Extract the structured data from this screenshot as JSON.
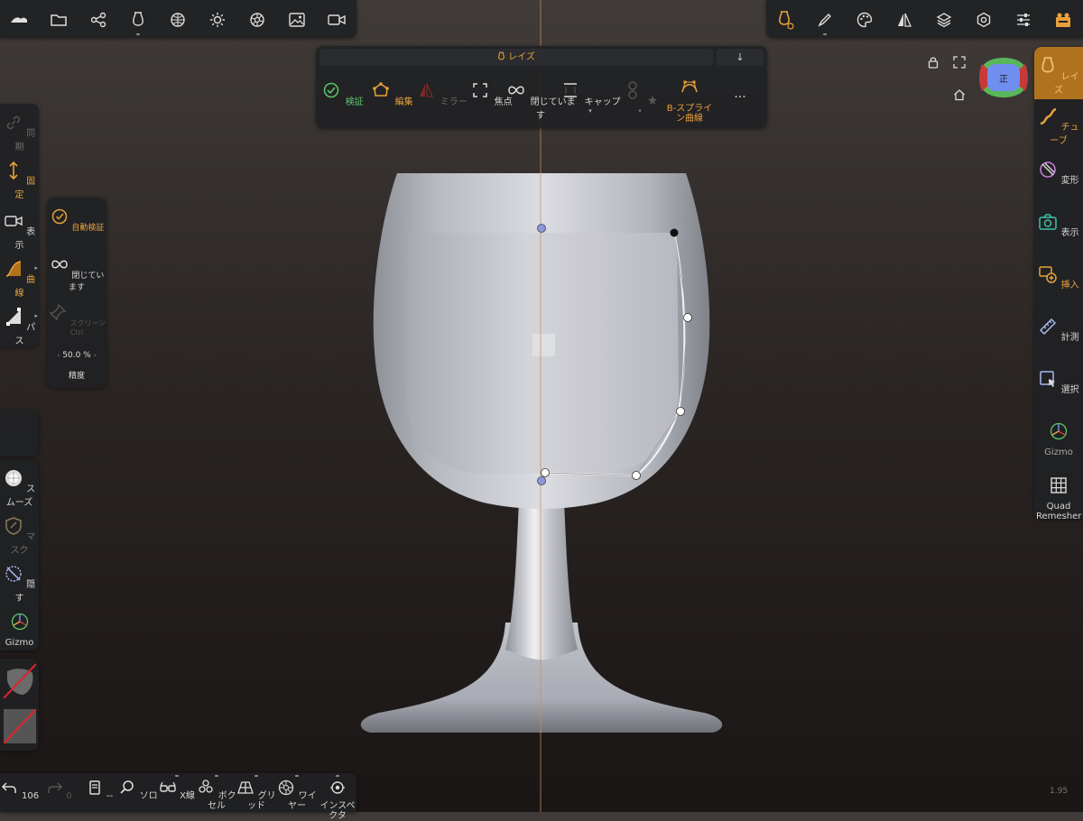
{
  "top_toolbar_left": {
    "icons": [
      "menu-icon",
      "folder-icon",
      "scene-graph-icon",
      "vase-icon",
      "sphere-icon",
      "light-icon",
      "material-icon",
      "image-icon",
      "camera-icon"
    ]
  },
  "top_toolbar_right": {
    "icons": [
      "lathe-tool-icon",
      "brush-icon",
      "palette-icon",
      "symmetry-icon",
      "layers-icon",
      "settings-icon",
      "sliders-icon",
      "user-icon"
    ]
  },
  "lathe_panel": {
    "title": "レイズ",
    "tools": [
      {
        "label": "検証",
        "state": "active-green"
      },
      {
        "label": "編集",
        "state": "active-orange"
      },
      {
        "label": "ミラー",
        "state": "disabled"
      },
      {
        "label": "焦点",
        "state": "normal"
      },
      {
        "label": "閉じています",
        "state": "normal"
      },
      {
        "label": "キャップ",
        "state": "normal"
      },
      {
        "label": "",
        "state": "disabled"
      },
      {
        "label": "B-スプライン曲線",
        "state": "active-orange"
      },
      {
        "label": "...",
        "state": "normal"
      }
    ]
  },
  "left_panel": {
    "items": [
      {
        "label": "同期",
        "state": "disabled"
      },
      {
        "label": "固定",
        "state": "orange"
      },
      {
        "label": "表示",
        "state": "normal"
      },
      {
        "label": "曲線",
        "state": "orange"
      },
      {
        "label": "パス",
        "state": "normal"
      }
    ]
  },
  "curve_popup": {
    "auto_validate": "自動検証",
    "closed": "閉じています",
    "screen": "スクリーン Ctrl",
    "precision_value": "50.0 %",
    "precision_label": "精度"
  },
  "left_panel_2": {
    "items": [
      {
        "label": "スムーズ"
      },
      {
        "label": "マスク"
      },
      {
        "label": "隠す"
      },
      {
        "label": "Gizmo"
      }
    ]
  },
  "right_panel": {
    "items": [
      {
        "label": "レイズ",
        "selected": true
      },
      {
        "label": "チューブ"
      },
      {
        "label": "変形"
      },
      {
        "label": "表示"
      },
      {
        "label": "挿入"
      },
      {
        "label": "計測"
      },
      {
        "label": "選択"
      },
      {
        "label": "Gizmo"
      },
      {
        "label": "Quad Remesher"
      }
    ]
  },
  "viewcube": {
    "label": "正"
  },
  "bottom_toolbar": {
    "items": [
      {
        "label": "106"
      },
      {
        "label": "0"
      },
      {
        "label": "--"
      },
      {
        "label": "ソロ"
      },
      {
        "label": "X線"
      },
      {
        "label": "ボクセル"
      },
      {
        "label": "グリッド"
      },
      {
        "label": "ワイヤー"
      },
      {
        "label": "インスペクタ"
      }
    ]
  },
  "fps": "1.95",
  "colors": {
    "accent": "#e8a13a",
    "selected_bg": "#b0731d",
    "valid": "#5cc46a",
    "panel": "#202124"
  }
}
